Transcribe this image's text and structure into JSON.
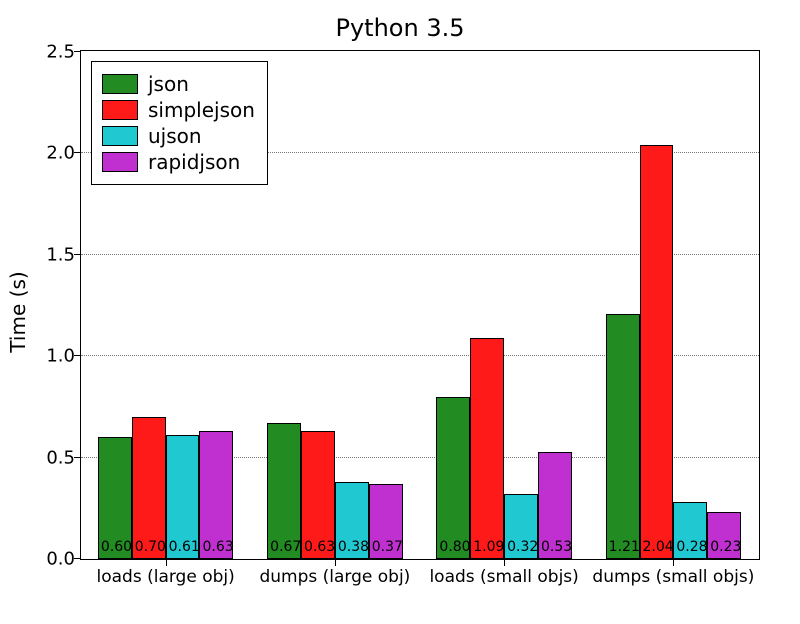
{
  "chart_data": {
    "type": "bar",
    "title": "Python 3.5",
    "xlabel": "",
    "ylabel": "Time (s)",
    "ylim": [
      0.0,
      2.5
    ],
    "yticks": [
      0.0,
      0.5,
      1.0,
      1.5,
      2.0,
      2.5
    ],
    "ytick_labels": [
      "0.0",
      "0.5",
      "1.0",
      "1.5",
      "2.0",
      "2.5"
    ],
    "categories": [
      "loads (large obj)",
      "dumps (large obj)",
      "loads (small objs)",
      "dumps (small objs)"
    ],
    "series": [
      {
        "name": "json",
        "color": "#228B22",
        "values": [
          0.6,
          0.67,
          0.8,
          1.21
        ]
      },
      {
        "name": "simplejson",
        "color": "#FF1A1A",
        "values": [
          0.7,
          0.63,
          1.09,
          2.04
        ]
      },
      {
        "name": "ujson",
        "color": "#20C8D2",
        "values": [
          0.61,
          0.38,
          0.32,
          0.28
        ]
      },
      {
        "name": "rapidjson",
        "color": "#C030D0",
        "values": [
          0.63,
          0.37,
          0.53,
          0.23
        ]
      }
    ],
    "value_labels": [
      [
        "0.60",
        "0.67",
        "0.80",
        "1.21"
      ],
      [
        "0.70",
        "0.63",
        "1.09",
        "2.04"
      ],
      [
        "0.61",
        "0.38",
        "0.32",
        "0.28"
      ],
      [
        "0.63",
        "0.37",
        "0.53",
        "0.23"
      ]
    ]
  }
}
